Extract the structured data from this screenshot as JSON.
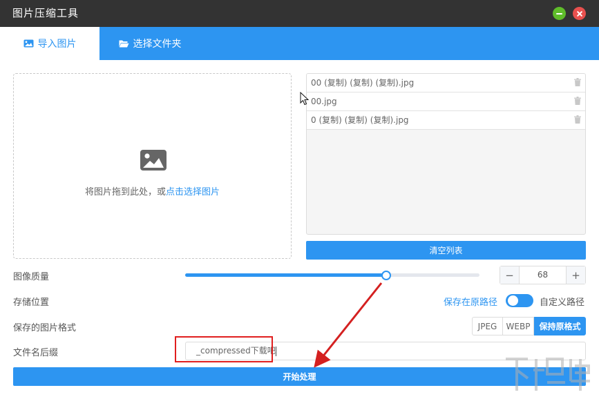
{
  "window": {
    "title": "图片压缩工具"
  },
  "tabs": [
    {
      "label": "导入图片",
      "icon": "image-icon",
      "active": true
    },
    {
      "label": "选择文件夹",
      "icon": "folder-open-icon",
      "active": false
    }
  ],
  "dropzone": {
    "hint_text": "将图片拖到此处，或",
    "hint_link": "点击选择图片"
  },
  "file_list": {
    "items": [
      {
        "name": "00 (复制) (复制) (复制).jpg"
      },
      {
        "name": "00.jpg"
      },
      {
        "name": "0 (复制) (复制) (复制).jpg"
      }
    ]
  },
  "clear_button": {
    "label": "清空列表"
  },
  "quality": {
    "label": "图像质量",
    "value": "68",
    "percent": 68,
    "minus": "−",
    "plus": "+"
  },
  "storage": {
    "label": "存储位置",
    "option_left": "保存在原路径",
    "option_right": "自定义路径"
  },
  "format": {
    "label": "保存的图片格式",
    "options": [
      "JPEG",
      "WEBP",
      "保持原格式"
    ],
    "selected": "保持原格式"
  },
  "suffix": {
    "label": "文件名后缀",
    "value": "_compressed下载吧"
  },
  "start_button": {
    "label": "开始处理"
  },
  "colors": {
    "accent": "#2d95f1",
    "titlebar": "#333333",
    "annotation": "#e01e1e"
  }
}
